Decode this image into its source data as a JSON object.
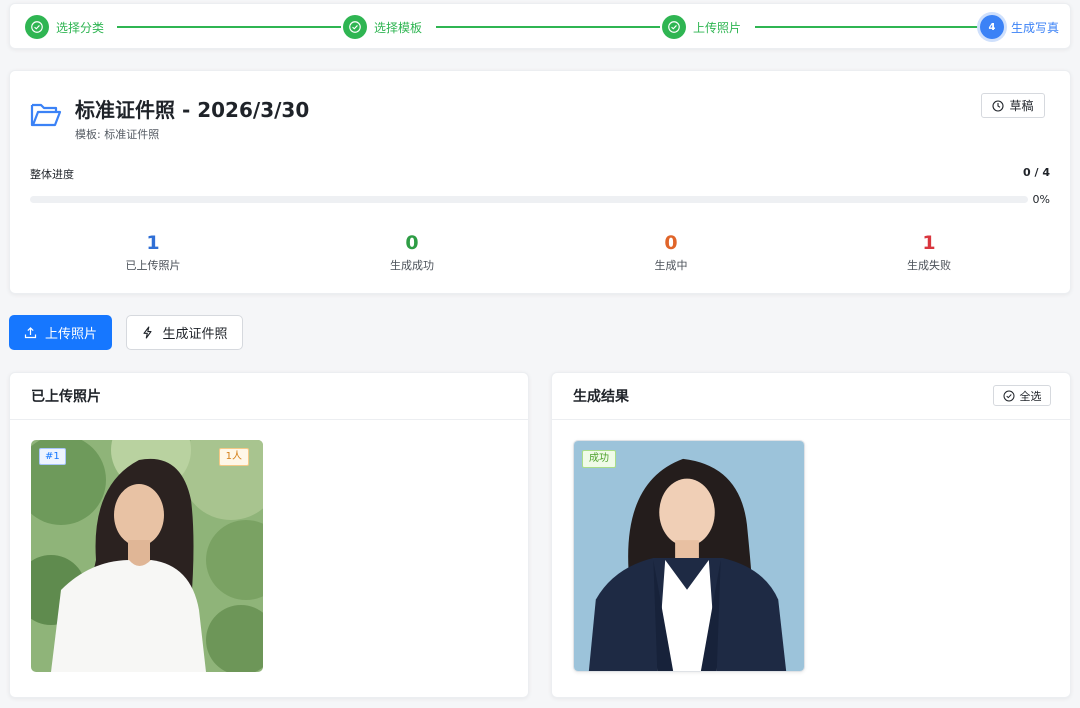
{
  "steps": [
    {
      "label": "选择分类",
      "status": "done",
      "icon": "check-circle-icon"
    },
    {
      "label": "选择模板",
      "status": "done",
      "icon": "check-circle-icon"
    },
    {
      "label": "上传照片",
      "status": "done",
      "icon": "check-circle-icon"
    },
    {
      "label": "生成写真",
      "status": "active",
      "number": "4"
    }
  ],
  "project": {
    "icon": "folder-open-icon",
    "title": "标准证件照 - 2026/3/30",
    "template": "模板: 标准证件照",
    "status": "草稿",
    "status_icon": "clock-icon"
  },
  "progress": {
    "label": "整体进度",
    "count": "0 / 4",
    "percent_text": "0%",
    "fraction": 0
  },
  "stats": [
    {
      "value": "1",
      "label": "已上传照片",
      "color": "#2f6fd6"
    },
    {
      "value": "0",
      "label": "生成成功",
      "color": "#2e9d45"
    },
    {
      "value": "0",
      "label": "生成中",
      "color": "#e0652a"
    },
    {
      "value": "1",
      "label": "生成失败",
      "color": "#d9363e"
    }
  ],
  "actions": {
    "upload": {
      "label": "上传照片",
      "icon": "upload-icon"
    },
    "generate": {
      "label": "生成证件照",
      "icon": "lightning-icon"
    }
  },
  "uploaded_panel": {
    "title": "已上传照片",
    "photos": [
      {
        "index_tag": "#1",
        "people_tag": "1人"
      }
    ]
  },
  "results_panel": {
    "title": "生成结果",
    "select_all": "全选",
    "select_all_icon": "check-circle-icon",
    "photos": [
      {
        "status_tag": "成功"
      }
    ]
  },
  "colors": {
    "accent": "#1677ff",
    "done": "#2fb552",
    "active_step": "#3b82f6"
  }
}
